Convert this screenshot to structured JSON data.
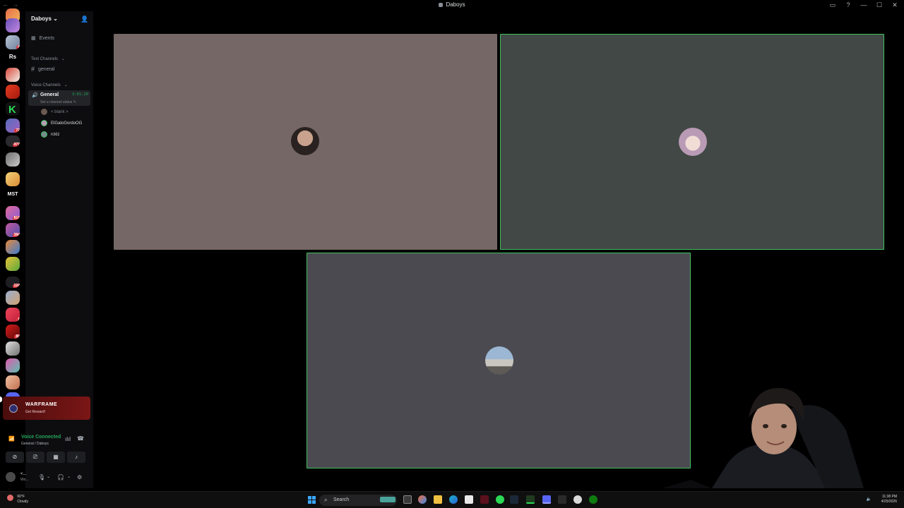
{
  "window": {
    "title": "Daboys",
    "controls": [
      "▭",
      "?",
      "—",
      "☐",
      "✕"
    ]
  },
  "server_rail": {
    "items": [
      {
        "badge": ""
      },
      {
        "badge": ""
      },
      {
        "badge": "4"
      },
      {
        "text": "Rs"
      },
      {
        "badge": ""
      },
      {
        "badge": ""
      },
      {
        "badge": ""
      },
      {
        "badge": "72"
      },
      {
        "badge": "477"
      },
      {
        "badge": ""
      },
      {
        "badge": ""
      },
      {
        "text": "MST"
      },
      {
        "badge": "810"
      },
      {
        "badge": "384"
      },
      {
        "badge": ""
      },
      {
        "badge": ""
      },
      {
        "badge": "124"
      },
      {
        "badge": ""
      },
      {
        "badge": "1"
      },
      {
        "badge": "80"
      },
      {
        "badge": ""
      },
      {
        "badge": ""
      },
      {
        "badge": ""
      },
      {
        "badge": "D"
      }
    ]
  },
  "sidebar": {
    "server_name": "Daboys",
    "events_label": "Events",
    "text_category": "Text Channels",
    "text_channels": [
      {
        "name": "general"
      }
    ],
    "voice_category": "Voice Channels",
    "voice_channel": {
      "name": "General",
      "timer": "3:01:20",
      "status_placeholder": "Set a channel status"
    },
    "voice_users": [
      {
        "name": "< blank >",
        "color": "#80848e"
      },
      {
        "name": "ElGatoGordoOG",
        "color": "#dbdee1"
      },
      {
        "name": "rcklz",
        "color": "#dbdee1"
      }
    ]
  },
  "promo": {
    "title": "WARFRAME",
    "subtitle": "Get Reward!"
  },
  "voice_panel": {
    "status": "Voice Connected",
    "location": "General / Daboys"
  },
  "user_panel": {
    "name": "<...",
    "status": "Wo..."
  },
  "tiles": [
    {
      "user": "tile-1",
      "speaking": false,
      "bg": "#756765"
    },
    {
      "user": "tile-2",
      "speaking": true,
      "bg": "#414845"
    },
    {
      "user": "tile-3",
      "speaking": true,
      "bg": "#4a4a50"
    }
  ],
  "taskbar": {
    "weather_temp": "60°F",
    "weather_desc": "Cloudy",
    "search_placeholder": "Search",
    "time": "11:38 PM",
    "date": "4/25/2026"
  },
  "colors": {
    "speaking_border": "#3fbf5d",
    "voice_green": "#23a55a",
    "badge_red": "#da373c"
  }
}
